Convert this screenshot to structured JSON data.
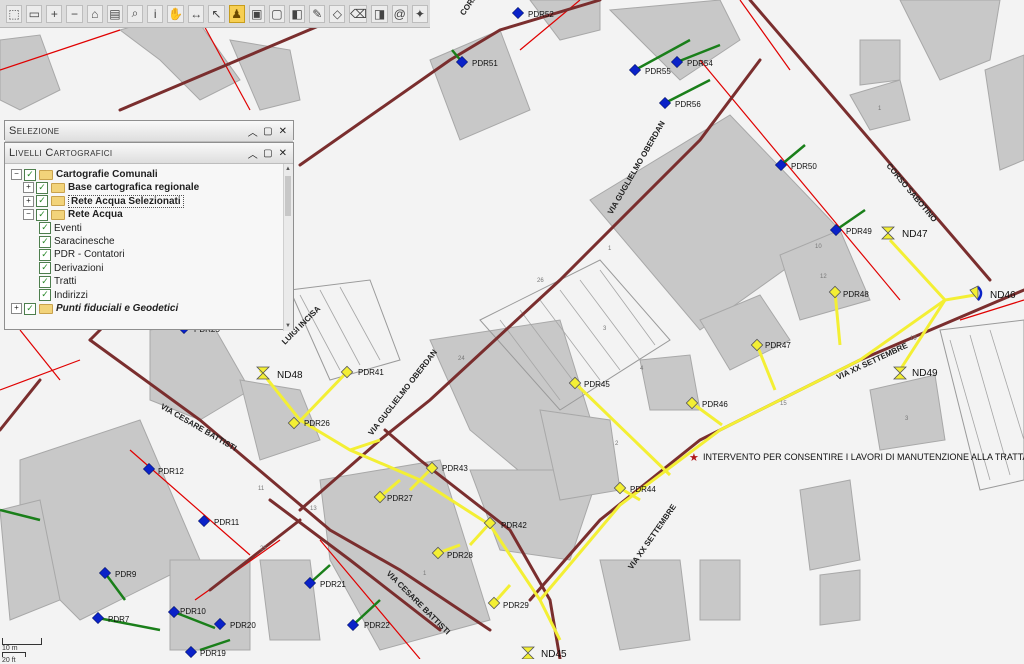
{
  "toolbar": {
    "buttons": [
      {
        "name": "pan-select-icon",
        "glyph": "⬚"
      },
      {
        "name": "zoom-box-icon",
        "glyph": "▭"
      },
      {
        "name": "zoom-in-icon",
        "glyph": "+"
      },
      {
        "name": "zoom-out-icon",
        "glyph": "−"
      },
      {
        "name": "zoom-full-icon",
        "glyph": "⌂"
      },
      {
        "name": "print-icon",
        "glyph": "▤"
      },
      {
        "name": "search-icon",
        "glyph": "⌕"
      },
      {
        "name": "info-icon",
        "glyph": "i"
      },
      {
        "name": "pan-icon",
        "glyph": "✋"
      },
      {
        "name": "measure-icon",
        "glyph": "↔"
      },
      {
        "name": "select-icon",
        "glyph": "↖"
      },
      {
        "name": "person-icon",
        "glyph": "♟",
        "accent": true
      },
      {
        "name": "frame-icon",
        "glyph": "▣"
      },
      {
        "name": "window-icon",
        "glyph": "▢"
      },
      {
        "name": "layer-icon",
        "glyph": "◧"
      },
      {
        "name": "edit-icon",
        "glyph": "✎"
      },
      {
        "name": "draw-icon",
        "glyph": "◇"
      },
      {
        "name": "eraser-icon",
        "glyph": "⌫"
      },
      {
        "name": "bucket-icon",
        "glyph": "◨"
      },
      {
        "name": "globe-icon",
        "glyph": "@"
      },
      {
        "name": "magic-icon",
        "glyph": "✦"
      }
    ]
  },
  "selection_panel": {
    "title": "Selezione"
  },
  "layers_panel": {
    "title": "Livelli Cartografici",
    "items": [
      {
        "label": "Cartografie Comunali",
        "level": 0,
        "exp": "−",
        "bold": true
      },
      {
        "label": "Base cartografica regionale",
        "level": 1,
        "exp": "+",
        "bold": true
      },
      {
        "label": "Rete Acqua Selezionati",
        "level": 1,
        "exp": "+",
        "bold": true,
        "selected": true
      },
      {
        "label": "Rete Acqua",
        "level": 1,
        "exp": "−",
        "bold": true
      },
      {
        "label": "Eventi",
        "level": 2
      },
      {
        "label": "Saracinesche",
        "level": 2
      },
      {
        "label": "PDR - Contatori",
        "level": 2
      },
      {
        "label": "Derivazioni",
        "level": 2
      },
      {
        "label": "Tratti",
        "level": 2
      },
      {
        "label": "Indirizzi",
        "level": 2
      },
      {
        "label": "Punti fiduciali e Geodetici",
        "level": 0,
        "exp": "+",
        "bold": true,
        "italic": true
      }
    ]
  },
  "map": {
    "streets": [
      "CORSO SABOTINO",
      "VIA GUGLIELMO OBERDAN",
      "VIA XX SETTEMBRE",
      "VIA CESARE BATTISTI",
      "LUIGI INCISA"
    ],
    "pdr_blue": [
      "PDR52",
      "PDR51",
      "PDR55",
      "PDR54",
      "PDR56",
      "PDR50",
      "PDR49",
      "PDR25",
      "PDR12",
      "PDR11",
      "PDR9",
      "PDR7",
      "PDR10",
      "PDR20",
      "PDR21",
      "PDR22",
      "PDR19"
    ],
    "pdr_yellow": [
      "PDR48",
      "PDR47",
      "PDR46",
      "PDR45",
      "PDR44",
      "PDR43",
      "PDR42",
      "PDR41",
      "PDR28",
      "PDR27",
      "PDR26",
      "PDR29"
    ],
    "nodes": [
      "ND47",
      "ND46",
      "ND49",
      "ND48",
      "ND45"
    ],
    "annotation": "INTERVENTO PER CONSENTIRE I LAVORI DI MANUTENZIONE ALLA TRATTA",
    "scale_top": "10 m",
    "scale_bottom": "20 ft"
  },
  "colors": {
    "pipe_brown": "#7a2e2e",
    "selected_yellow": "#f3ef34",
    "meter_blue": "#0a22c8",
    "service_green": "#1a7f1a",
    "boundary_red": "#e00000",
    "building": "#c8c8c8"
  }
}
